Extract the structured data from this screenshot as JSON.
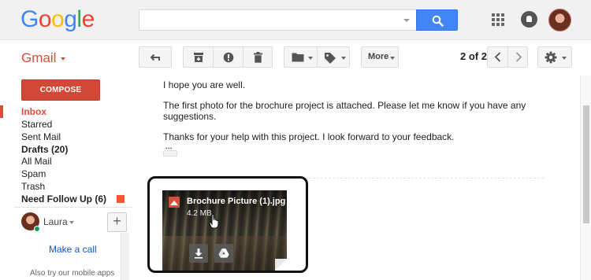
{
  "header": {
    "logo_letters": [
      {
        "char": "G",
        "color": "#4285f4"
      },
      {
        "char": "o",
        "color": "#ea4335"
      },
      {
        "char": "o",
        "color": "#fbbc05"
      },
      {
        "char": "g",
        "color": "#4285f4"
      },
      {
        "char": "l",
        "color": "#34a853"
      },
      {
        "char": "e",
        "color": "#ea4335"
      }
    ],
    "search": {
      "value": "",
      "placeholder": ""
    },
    "icons": [
      "search-icon",
      "apps-icon",
      "notifications-icon",
      "profile-avatar"
    ]
  },
  "toolbar": {
    "app_label": "Gmail",
    "more_label": "More",
    "page_count": "2 of 2",
    "icons": [
      "reply-icon",
      "archive-icon",
      "report-spam-icon",
      "delete-icon",
      "folder-icon",
      "label-icon",
      "chevron-left-icon",
      "chevron-right-icon",
      "gear-icon"
    ]
  },
  "sidebar": {
    "compose_label": "COMPOSE",
    "items": [
      {
        "label": "Inbox",
        "state": "active"
      },
      {
        "label": "Starred",
        "state": "normal"
      },
      {
        "label": "Sent Mail",
        "state": "normal"
      },
      {
        "label": "Drafts (20)",
        "state": "bold"
      },
      {
        "label": "All Mail",
        "state": "normal"
      },
      {
        "label": "Spam",
        "state": "normal"
      },
      {
        "label": "Trash",
        "state": "normal"
      },
      {
        "label": "Need Follow Up (6)",
        "state": "bold"
      }
    ],
    "label_color": "#f15a30",
    "chat": {
      "user_name": "Laura",
      "make_call_label": "Make a call",
      "mobile_apps_text": "Also try our mobile apps"
    }
  },
  "message": {
    "lines": [
      "I hope you are well.",
      "The first photo for the brochure project is attached. Please let me know if you have any",
      "suggestions.",
      "Thanks for your help with this project. I look forward to your feedback."
    ],
    "attachment": {
      "filename": "Brochure Picture (1).jpg",
      "size": "4.2 MB",
      "icons": [
        "image-file-icon",
        "download-icon",
        "google-drive-icon",
        "hand-cursor-icon"
      ]
    }
  },
  "colors": {
    "brand_red": "#dd4b39",
    "search_blue": "#4285f4",
    "link_blue": "#1155cc"
  }
}
